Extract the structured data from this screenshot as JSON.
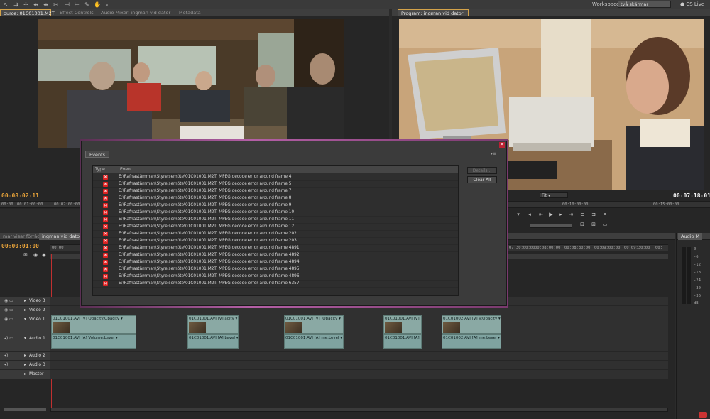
{
  "toolbar": {
    "workspace_label": "Workspace:",
    "workspace_value": "två skärmar",
    "cs_live": "CS Live"
  },
  "source_panel": {
    "tabs": [
      "ource: 01C01001.M2T",
      "Effect Controls",
      "Audio Mixer: ingman vid dator",
      "Metadata"
    ],
    "timecode": "00:08:02:11",
    "ruler": [
      "00:00",
      "00:01:00:00",
      "00:02:00:00"
    ]
  },
  "program_panel": {
    "tab": "Program: ingman vid dator",
    "fit": "Fit",
    "timecode": "00:07:18:01",
    "ruler": [
      "00:10:00:00",
      "00:15:00:00"
    ]
  },
  "timeline": {
    "tabs": [
      "mar visar förråd",
      "ingman vid dator"
    ],
    "timecode": "00:00:01:00",
    "ruler": [
      "00:00",
      "07:30:00:00",
      "00:08:00:00",
      "00:08:30:00",
      "00:09:00:00",
      "00:09:30:00",
      "00:"
    ],
    "tracks": [
      {
        "name": "Video 3"
      },
      {
        "name": "Video 2"
      },
      {
        "name": "Video 1"
      },
      {
        "name": "Audio 1"
      },
      {
        "name": "Audio 2"
      },
      {
        "name": "Audio 3"
      },
      {
        "name": "Master"
      }
    ],
    "video_clips": [
      {
        "title": "01C01001.AVI [V]  Opacity:Opacity ▾"
      },
      {
        "title": "01C01001.AVI [V]  acity ▾"
      },
      {
        "title": "01C01001.AVI [V]  :Opacity ▾"
      },
      {
        "title": "01C01001.AVI [V]"
      },
      {
        "title": "01C01002.AVI [V]  y:Opacity ▾"
      }
    ],
    "audio_clips": [
      {
        "title": "01C01001.AVI [A]  Volume:Level ▾"
      },
      {
        "title": "01C01001.AVI [A]  Level ▾"
      },
      {
        "title": "01C01001.AVI [A]  me:Level ▾"
      },
      {
        "title": "01C01001.AVI [A]"
      },
      {
        "title": "01C01002.AVI [A]  me:Level ▾"
      }
    ]
  },
  "audio_meters": {
    "tab": "Audio M",
    "labels": [
      "0",
      "-6",
      "-12",
      "-18",
      "-24",
      "-30",
      "-36",
      "dB"
    ]
  },
  "events_dialog": {
    "tab": "Events",
    "col_type": "Type",
    "col_event": "Event",
    "button_details": "Details...",
    "button_clear": "Clear All",
    "events": [
      "E:\\Rafnastämman\\Styrelsemöte\\01C01001.M2T: MPEG decode error around frame 4",
      "E:\\Rafnastämman\\Styrelsemöte\\01C01001.M2T: MPEG decode error around frame 5",
      "E:\\Rafnastämman\\Styrelsemöte\\01C01001.M2T: MPEG decode error around frame 7",
      "E:\\Rafnastämman\\Styrelsemöte\\01C01001.M2T: MPEG decode error around frame 8",
      "E:\\Rafnastämman\\Styrelsemöte\\01C01001.M2T: MPEG decode error around frame 9",
      "E:\\Rafnastämman\\Styrelsemöte\\01C01001.M2T: MPEG decode error around frame 10",
      "E:\\Rafnastämman\\Styrelsemöte\\01C01001.M2T: MPEG decode error around frame 11",
      "E:\\Rafnastämman\\Styrelsemöte\\01C01001.M2T: MPEG decode error around frame 12",
      "E:\\Rafnastämman\\Styrelsemöte\\01C01001.M2T: MPEG decode error around frame 202",
      "E:\\Rafnastämman\\Styrelsemöte\\01C01001.M2T: MPEG decode error around frame 203",
      "E:\\Rafnastämman\\Styrelsemöte\\01C01001.M2T: MPEG decode error around frame 4891",
      "E:\\Rafnastämman\\Styrelsemöte\\01C01001.M2T: MPEG decode error around frame 4892",
      "E:\\Rafnastämman\\Styrelsemöte\\01C01001.M2T: MPEG decode error around frame 4894",
      "E:\\Rafnastämman\\Styrelsemöte\\01C01001.M2T: MPEG decode error around frame 4895",
      "E:\\Rafnastämman\\Styrelsemöte\\01C01001.M2T: MPEG decode error around frame 4896",
      "E:\\Rafnastämman\\Styrelsemöte\\01C01001.M2T: MPEG decode error around frame 6357"
    ]
  },
  "colors": {
    "timecode_accent": "#e8a33a",
    "error_icon": "#dd2222",
    "clip_fill": "#8aa9a4",
    "dialog_glow": "#b45fa6"
  }
}
